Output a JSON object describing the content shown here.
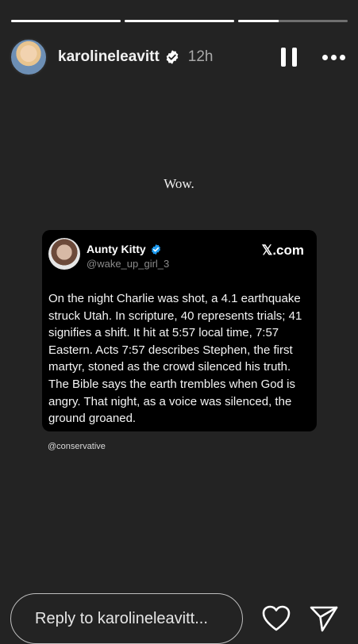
{
  "story": {
    "progress": [
      1,
      1,
      0.37
    ]
  },
  "header": {
    "username": "karolineleavitt",
    "time": "12h",
    "verified_icon": "verified-badge-icon",
    "pause_icon": "pause-icon",
    "more_icon": "more-options-icon"
  },
  "caption": "Wow.",
  "tweet": {
    "name": "Aunty Kitty",
    "handle": "@wake_up_girl_3",
    "source": "𝕏.com",
    "body": "On the night Charlie was shot, a 4.1 earthquake struck Utah. In scripture, 40 represents trials; 41 signifies a shift. It hit at 5:57 local time, 7:57 Eastern. Acts 7:57 describes Stephen, the first martyr, stoned as the crowd silenced his truth. The Bible says the earth trembles when God is angry. That night, as a voice was silenced, the ground groaned."
  },
  "tag": "@conservative",
  "footer": {
    "reply_placeholder": "Reply to karolineleavitt...",
    "like_icon": "heart-icon",
    "share_icon": "send-icon"
  }
}
